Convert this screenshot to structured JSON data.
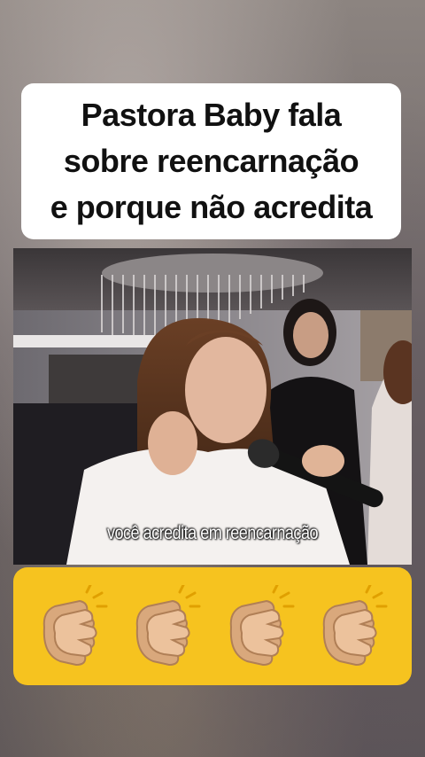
{
  "title": {
    "lines": [
      "Pastora Baby fala",
      "sobre reencarnação",
      "e porque não acredita"
    ]
  },
  "video": {
    "caption": "você acredita em reencarnação"
  },
  "reactions": {
    "icons": [
      "clapping-hands-icon",
      "clapping-hands-icon",
      "clapping-hands-icon",
      "clapping-hands-icon"
    ],
    "bar_color": "#f6c31f"
  }
}
